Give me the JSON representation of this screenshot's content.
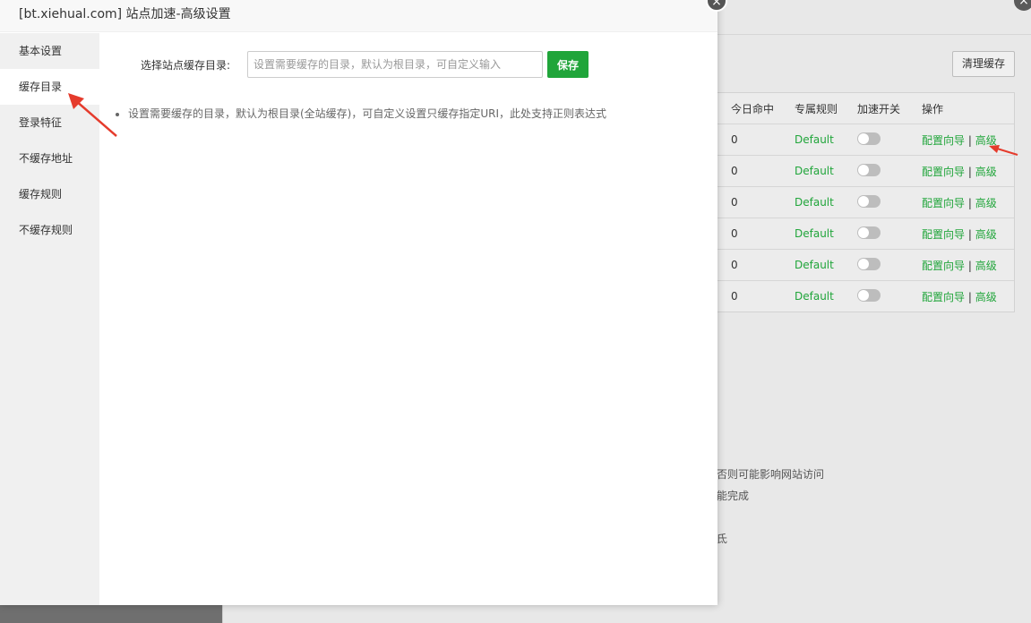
{
  "modal": {
    "title": "[bt.xiehual.com] 站点加速-高级设置",
    "close_glyph": "×"
  },
  "sidebar": {
    "items": [
      {
        "label": "基本设置",
        "active": false
      },
      {
        "label": "缓存目录",
        "active": true
      },
      {
        "label": "登录特征",
        "active": false
      },
      {
        "label": "不缓存地址",
        "active": false
      },
      {
        "label": "缓存规则",
        "active": false
      },
      {
        "label": "不缓存规则",
        "active": false
      }
    ]
  },
  "form": {
    "label": "选择站点缓存目录:",
    "value": "",
    "placeholder": "设置需要缓存的目录，默认为根目录，可自定义输入",
    "save_label": "保存"
  },
  "tips": [
    "设置需要缓存的目录，默认为根目录(全站缓存)，可自定义设置只缓存指定URI，此处支持正则表达式"
  ],
  "background": {
    "clear_cache_label": "清理缓存",
    "close_glyph": "×",
    "table": {
      "headers": [
        "今日命中",
        "专属规则",
        "加速开关",
        "操作"
      ],
      "rows": [
        {
          "hits": "0",
          "rule": "Default",
          "wizard": "配置向导",
          "sep": "|",
          "advanced": "高级"
        },
        {
          "hits": "0",
          "rule": "Default",
          "wizard": "配置向导",
          "sep": "|",
          "advanced": "高级"
        },
        {
          "hits": "0",
          "rule": "Default",
          "wizard": "配置向导",
          "sep": "|",
          "advanced": "高级"
        },
        {
          "hits": "0",
          "rule": "Default",
          "wizard": "配置向导",
          "sep": "|",
          "advanced": "高级"
        },
        {
          "hits": "0",
          "rule": "Default",
          "wizard": "配置向导",
          "sep": "|",
          "advanced": "高级"
        },
        {
          "hits": "0",
          "rule": "Default",
          "wizard": "配置向导",
          "sep": "|",
          "advanced": "高级"
        }
      ]
    },
    "notes": [
      "否则可能影响网站访问",
      "能完成",
      "氐"
    ]
  },
  "colors": {
    "accent": "#20a53a",
    "arrow": "#e53b2c"
  }
}
